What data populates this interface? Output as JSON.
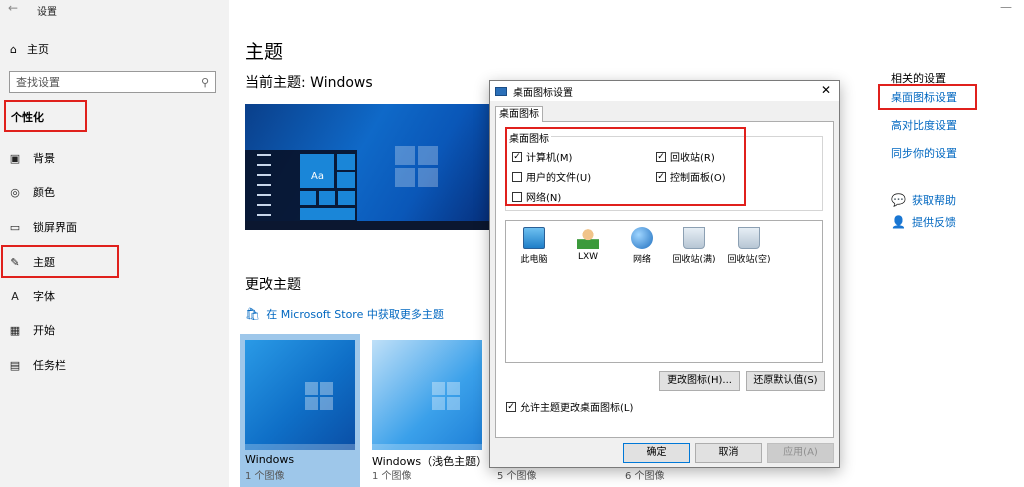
{
  "app": {
    "title": "设置",
    "back": "←",
    "corner": "—"
  },
  "sidebar": {
    "home": "主页",
    "search_placeholder": "查找设置",
    "section": "个性化",
    "items": [
      {
        "label": "背景",
        "icon": "image-icon"
      },
      {
        "label": "颜色",
        "icon": "palette-icon"
      },
      {
        "label": "锁屏界面",
        "icon": "lockscreen-icon"
      },
      {
        "label": "主题",
        "icon": "theme-icon"
      },
      {
        "label": "字体",
        "icon": "font-icon"
      },
      {
        "label": "开始",
        "icon": "start-icon"
      },
      {
        "label": "任务栏",
        "icon": "taskbar-icon"
      }
    ]
  },
  "main": {
    "title": "主题",
    "current_theme": "当前主题: Windows",
    "preview_aa": "Aa",
    "change_title": "更改主题",
    "store_link": "在 Microsoft Store 中获取更多主题",
    "themes": [
      {
        "name": "Windows",
        "count": "1 个图像"
      },
      {
        "name": "Windows（浅色主题）",
        "count": "1 个图像"
      }
    ],
    "extra_counts": [
      "5 个图像",
      "6 个图像"
    ]
  },
  "related": {
    "title": "相关的设置",
    "links": [
      "桌面图标设置",
      "高对比度设置",
      "同步你的设置"
    ],
    "help": "获取帮助",
    "feedback": "提供反馈"
  },
  "dialog": {
    "title": "桌面图标设置",
    "close": "✕",
    "tab": "桌面图标",
    "group_label": "桌面图标",
    "checkboxes": [
      {
        "label": "计算机(M)",
        "checked": true
      },
      {
        "label": "回收站(R)",
        "checked": true
      },
      {
        "label": "用户的文件(U)",
        "checked": false
      },
      {
        "label": "控制面板(O)",
        "checked": true
      },
      {
        "label": "网络(N)",
        "checked": false
      }
    ],
    "icons": [
      "此电脑",
      "LXW",
      "网络",
      "回收站(满)",
      "回收站(空)"
    ],
    "change_icon": "更改图标(H)...",
    "restore_default": "还原默认值(S)",
    "allow_themes": "允许主题更改桌面图标(L)",
    "ok": "确定",
    "cancel": "取消",
    "apply": "应用(A)"
  },
  "colors": {
    "accent": "#0067c0",
    "highlight_box": "#e0201c",
    "selected_theme": "#9ec7ea"
  }
}
